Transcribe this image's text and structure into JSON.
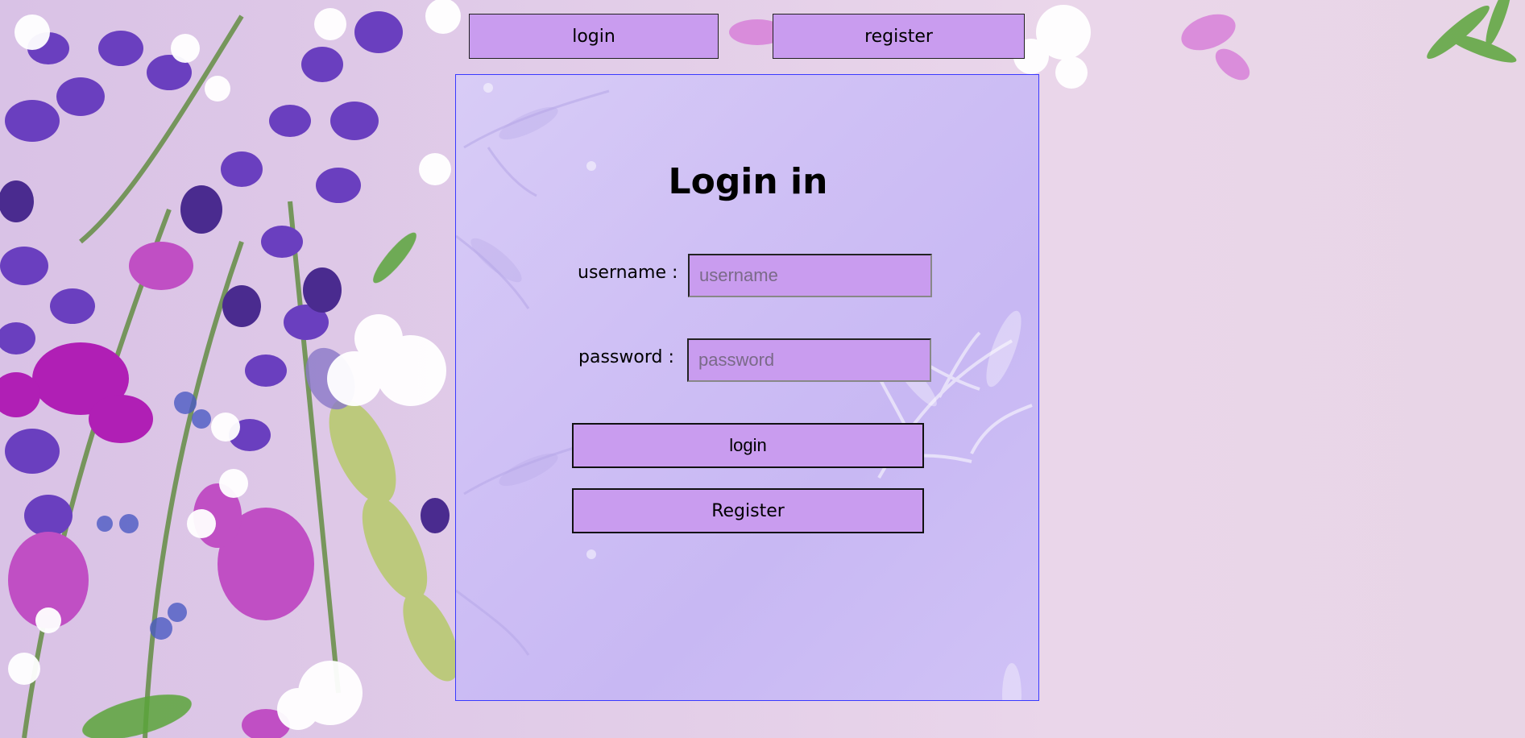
{
  "tabs": {
    "login_label": "login",
    "register_label": "register"
  },
  "form": {
    "title": "Login in",
    "username_label": "username :",
    "username_placeholder": "username",
    "password_label": "password :",
    "password_placeholder": "password",
    "login_button": "login",
    "register_button": "Register"
  },
  "colors": {
    "button_fill": "#c99cef",
    "panel_border": "#3a3aff"
  },
  "icons": {
    "background_image": "floral-background"
  }
}
